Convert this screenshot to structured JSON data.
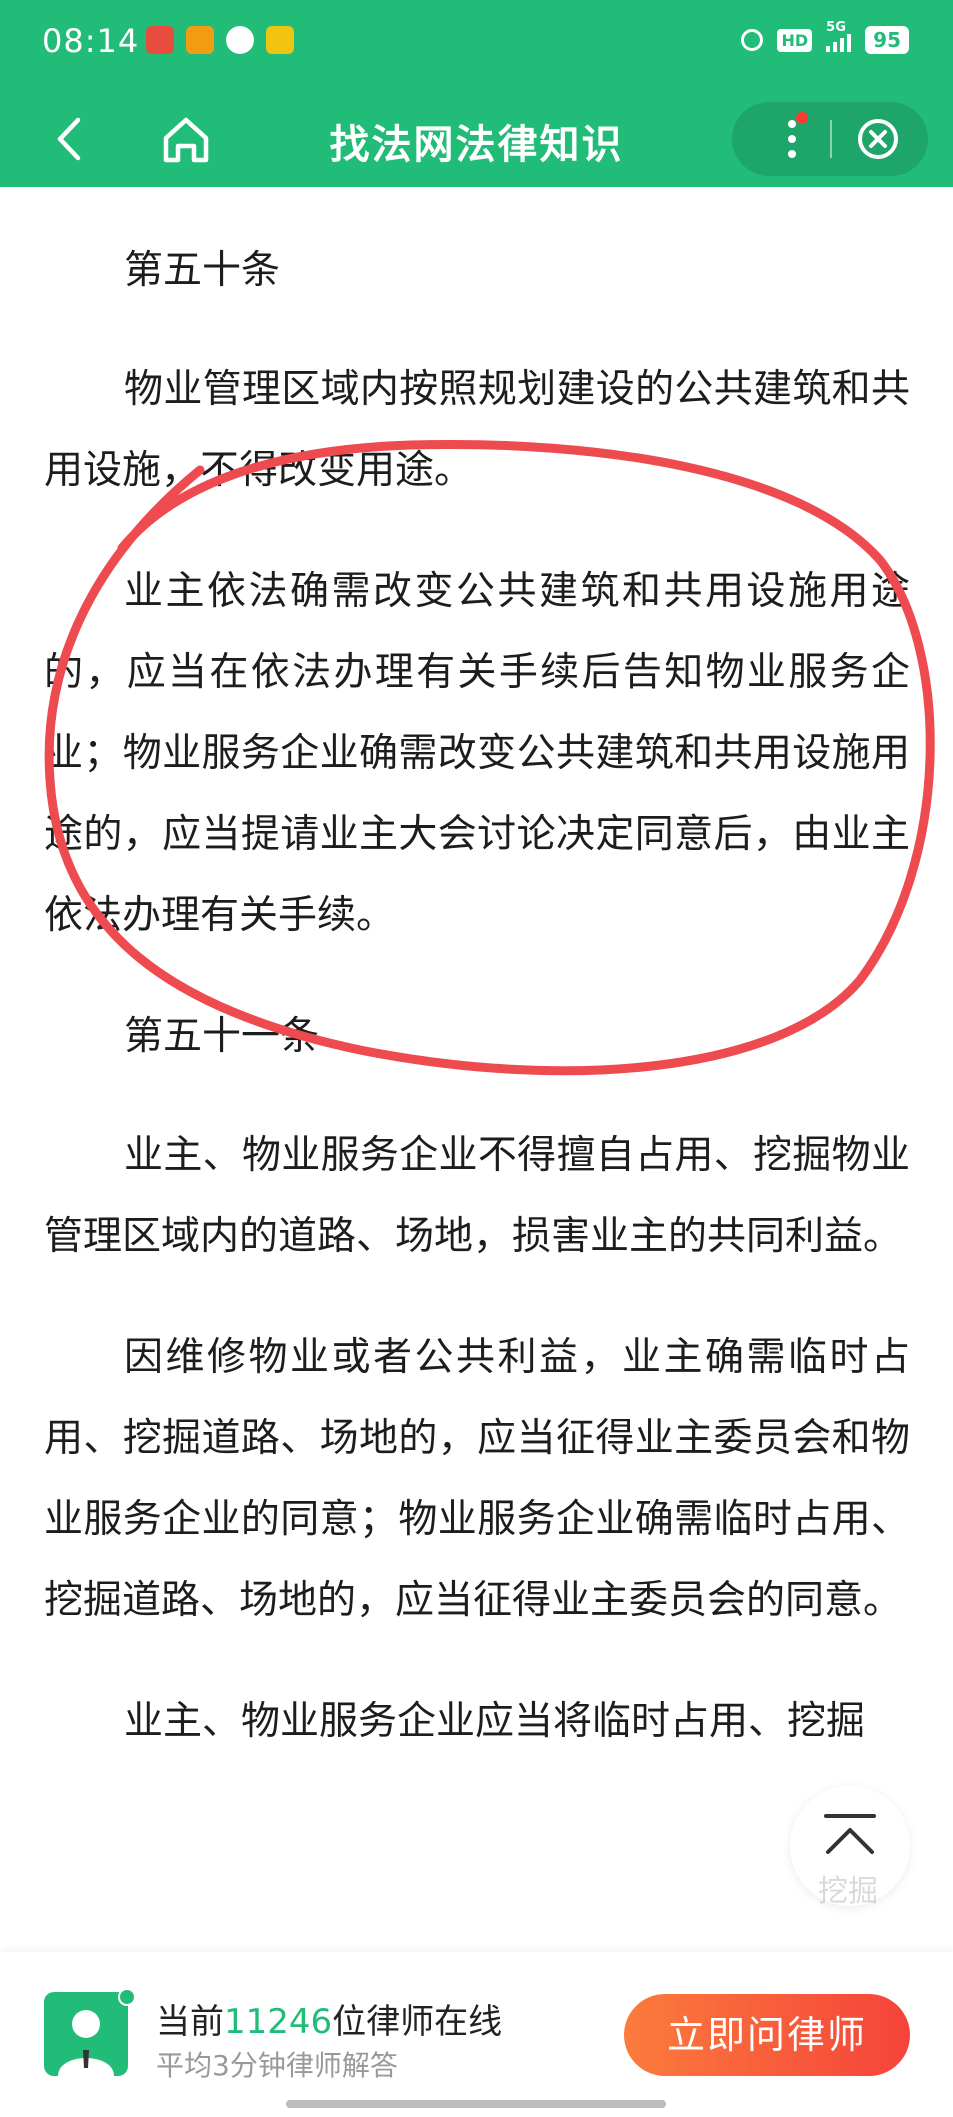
{
  "status_bar": {
    "time": "08:14",
    "hd_label": "HD",
    "network_label": "5G",
    "battery": "95"
  },
  "nav": {
    "title": "找法网法律知识"
  },
  "article": {
    "paragraphs": [
      {
        "text": "第五十条",
        "kind": "heading"
      },
      {
        "text": "物业管理区域内按照规划建设的公共建筑和共用设施，不得改变用途。",
        "kind": "body"
      },
      {
        "text": "业主依法确需改变公共建筑和共用设施用途的，应当在依法办理有关手续后告知物业服务企业；物业服务企业确需改变公共建筑和共用设施用途的，应当提请业主大会讨论决定同意后，由业主依法办理有关手续。",
        "kind": "body"
      },
      {
        "text": "第五十一条",
        "kind": "heading"
      },
      {
        "text": "业主、物业服务企业不得擅自占用、挖掘物业管理区域内的道路、场地，损害业主的共同利益。",
        "kind": "body"
      },
      {
        "text": "因维修物业或者公共利益，业主确需临时占用、挖掘道路、场地的，应当征得业主委员会和物业服务企业的同意；物业服务企业确需临时占用、挖掘道路、场地的，应当征得业主委员会的同意。",
        "kind": "body"
      },
      {
        "text": "业主、物业服务企业应当将临时占用、挖掘",
        "kind": "body"
      }
    ]
  },
  "back_to_top": {
    "label": "挖掘"
  },
  "bottom_bar": {
    "line1_prefix": "当前",
    "lawyer_count": "11246",
    "line1_suffix": "位律师在线",
    "line2": "平均3分钟律师解答",
    "button_label": "立即问律师"
  },
  "colors": {
    "brand_green": "#22bc79",
    "annotation_red": "#ee4b50",
    "cta_gradient_start": "#fb7b3c",
    "cta_gradient_end": "#f5433a"
  }
}
